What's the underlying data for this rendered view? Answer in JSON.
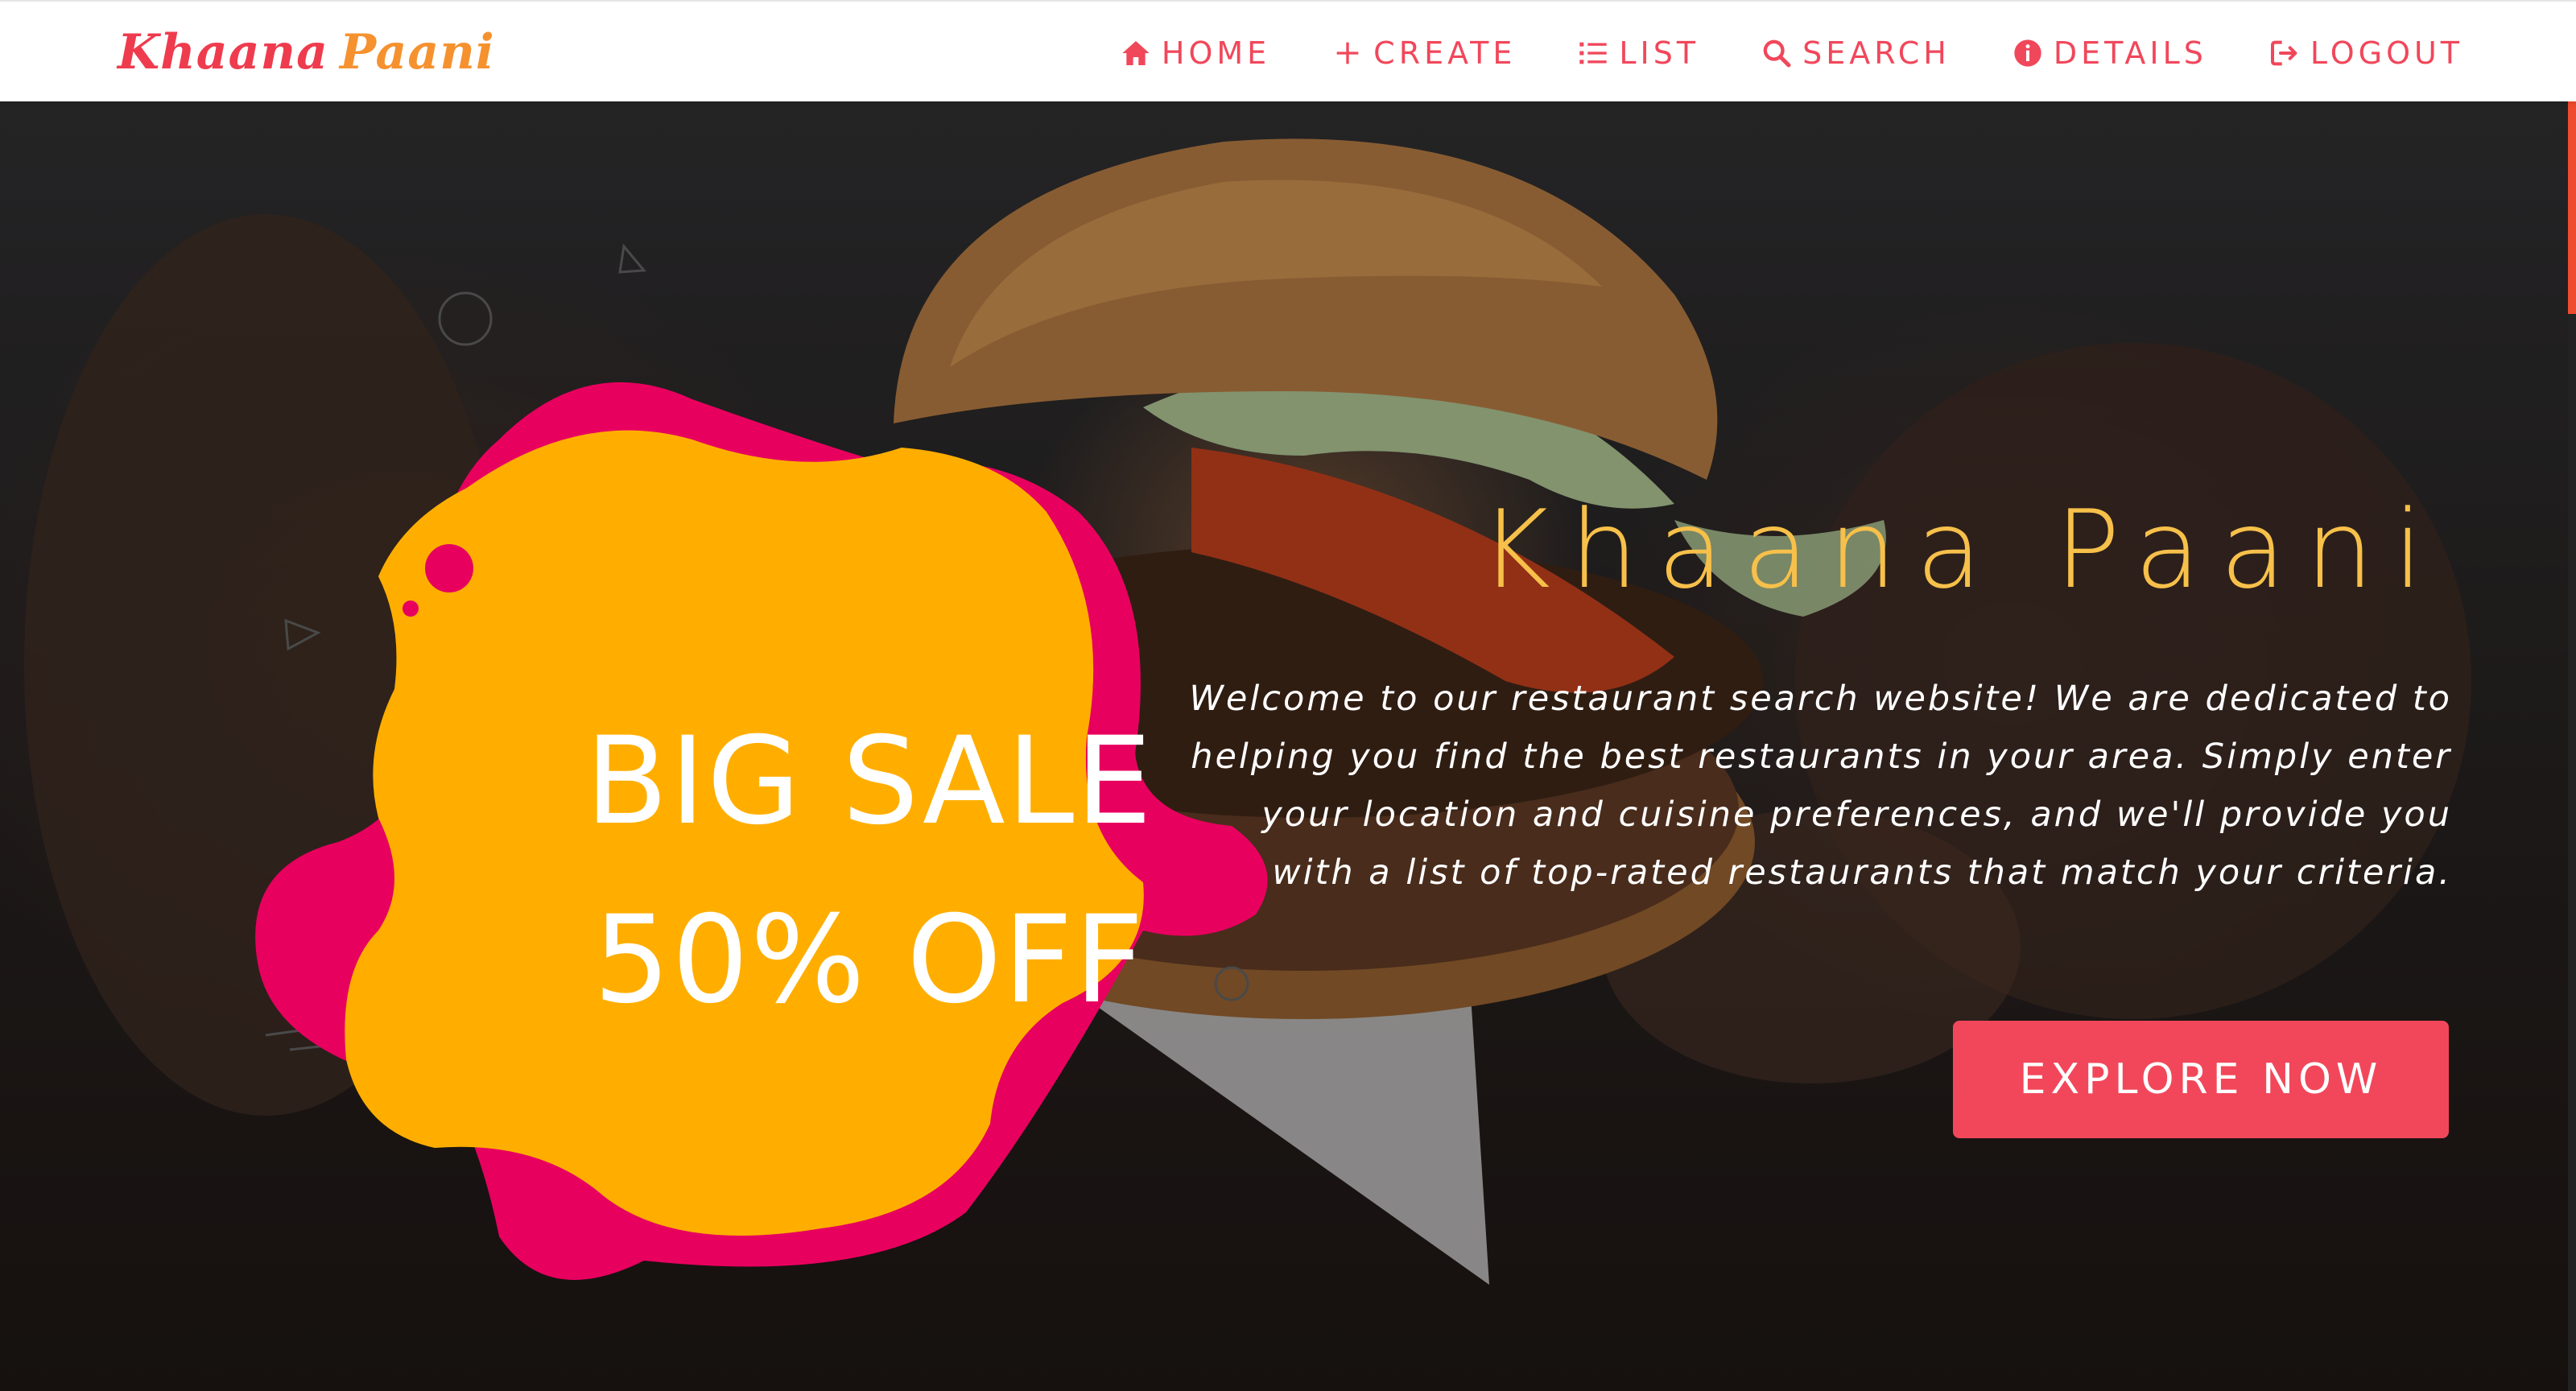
{
  "brand": {
    "word1": "Khaana",
    "word2": "Paani"
  },
  "nav": {
    "items": [
      {
        "label": "HOME",
        "icon": "home-icon"
      },
      {
        "label": "CREATE",
        "icon": "plus-icon"
      },
      {
        "label": "LIST",
        "icon": "list-icon"
      },
      {
        "label": "SEARCH",
        "icon": "search-icon"
      },
      {
        "label": "DETAILS",
        "icon": "info-icon"
      },
      {
        "label": "LOGOUT",
        "icon": "logout-icon"
      }
    ]
  },
  "hero": {
    "sale_line1": "BIG SALE",
    "sale_line2": "50% OFF",
    "title": "Khaana Paani",
    "description": "Welcome to our restaurant search website! We are dedicated to helping you find the best restaurants in your area. Simply enter your location and cuisine preferences, and we'll provide you with a list of top-rated restaurants that match your criteria.",
    "cta_label": "EXPLORE NOW"
  },
  "colors": {
    "brand_red": "#ef3b4e",
    "brand_orange": "#f5922f",
    "nav_text": "#f1475b",
    "title_gold": "#f7c04a",
    "cta_bg": "#f2475a",
    "blob_yellow": "#ffae00",
    "blob_pink": "#e8005f"
  }
}
